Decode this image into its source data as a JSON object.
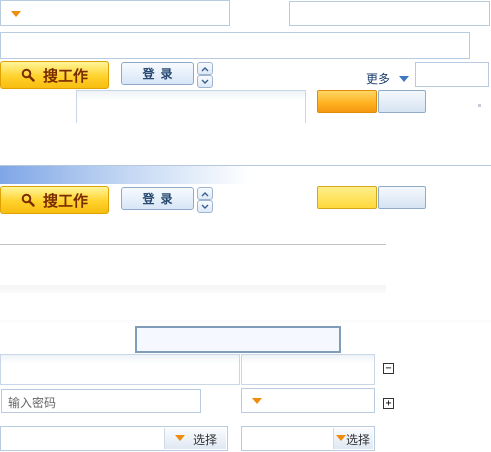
{
  "search_button": {
    "label": "搜工作"
  },
  "login_button": {
    "label": "登录"
  },
  "more": {
    "label": "更多"
  },
  "password_input": {
    "placeholder": "输入密码"
  },
  "select_buttons": [
    {
      "label": "选择"
    },
    {
      "label": "选择"
    }
  ],
  "colors": {
    "accent_orange": "#f08c0c",
    "link_blue": "#3f78c2",
    "border_blue": "#b8cbe0"
  }
}
